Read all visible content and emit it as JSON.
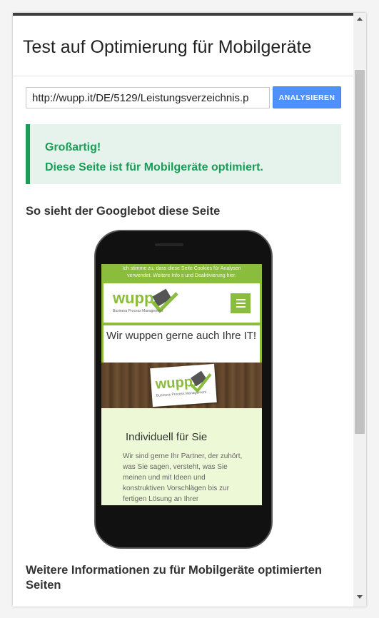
{
  "page": {
    "title": "Test auf Optimierung für Mobilgeräte"
  },
  "form": {
    "url_value": "http://wupp.it/DE/5129/Leistungsverzeichnis.p",
    "analyze_label": "ANALYSIEREN"
  },
  "result": {
    "line1": "Großartig!",
    "line2": "Diese Seite ist für Mobilgeräte optimiert.",
    "accent_color": "#1a9e57"
  },
  "preview": {
    "heading": "So sieht der Googlebot diese Seite",
    "cookie_line1": "Ich stimme zu, dass diese Seite Cookies für Analysen",
    "cookie_line2": "verwendet. Weitere Info  s und Deaktivierung hier.",
    "logo_text": "wupp.",
    "logo_sub": "Business Process Management",
    "tagline": "Wir wuppen gerne auch Ihre IT!",
    "section_title": "Individuell für Sie",
    "section_body": "Wir sind gerne Ihr Partner, der zuhört, was Sie sagen, versteht, was Sie meinen und mit Ideen und konstruktiven Vorschlägen bis zur fertigen Lösung an Ihrer",
    "brand_color": "#8bbd3c"
  },
  "more_info": {
    "heading": "Weitere Informationen zu für Mobilgeräte optimierten Seiten"
  }
}
